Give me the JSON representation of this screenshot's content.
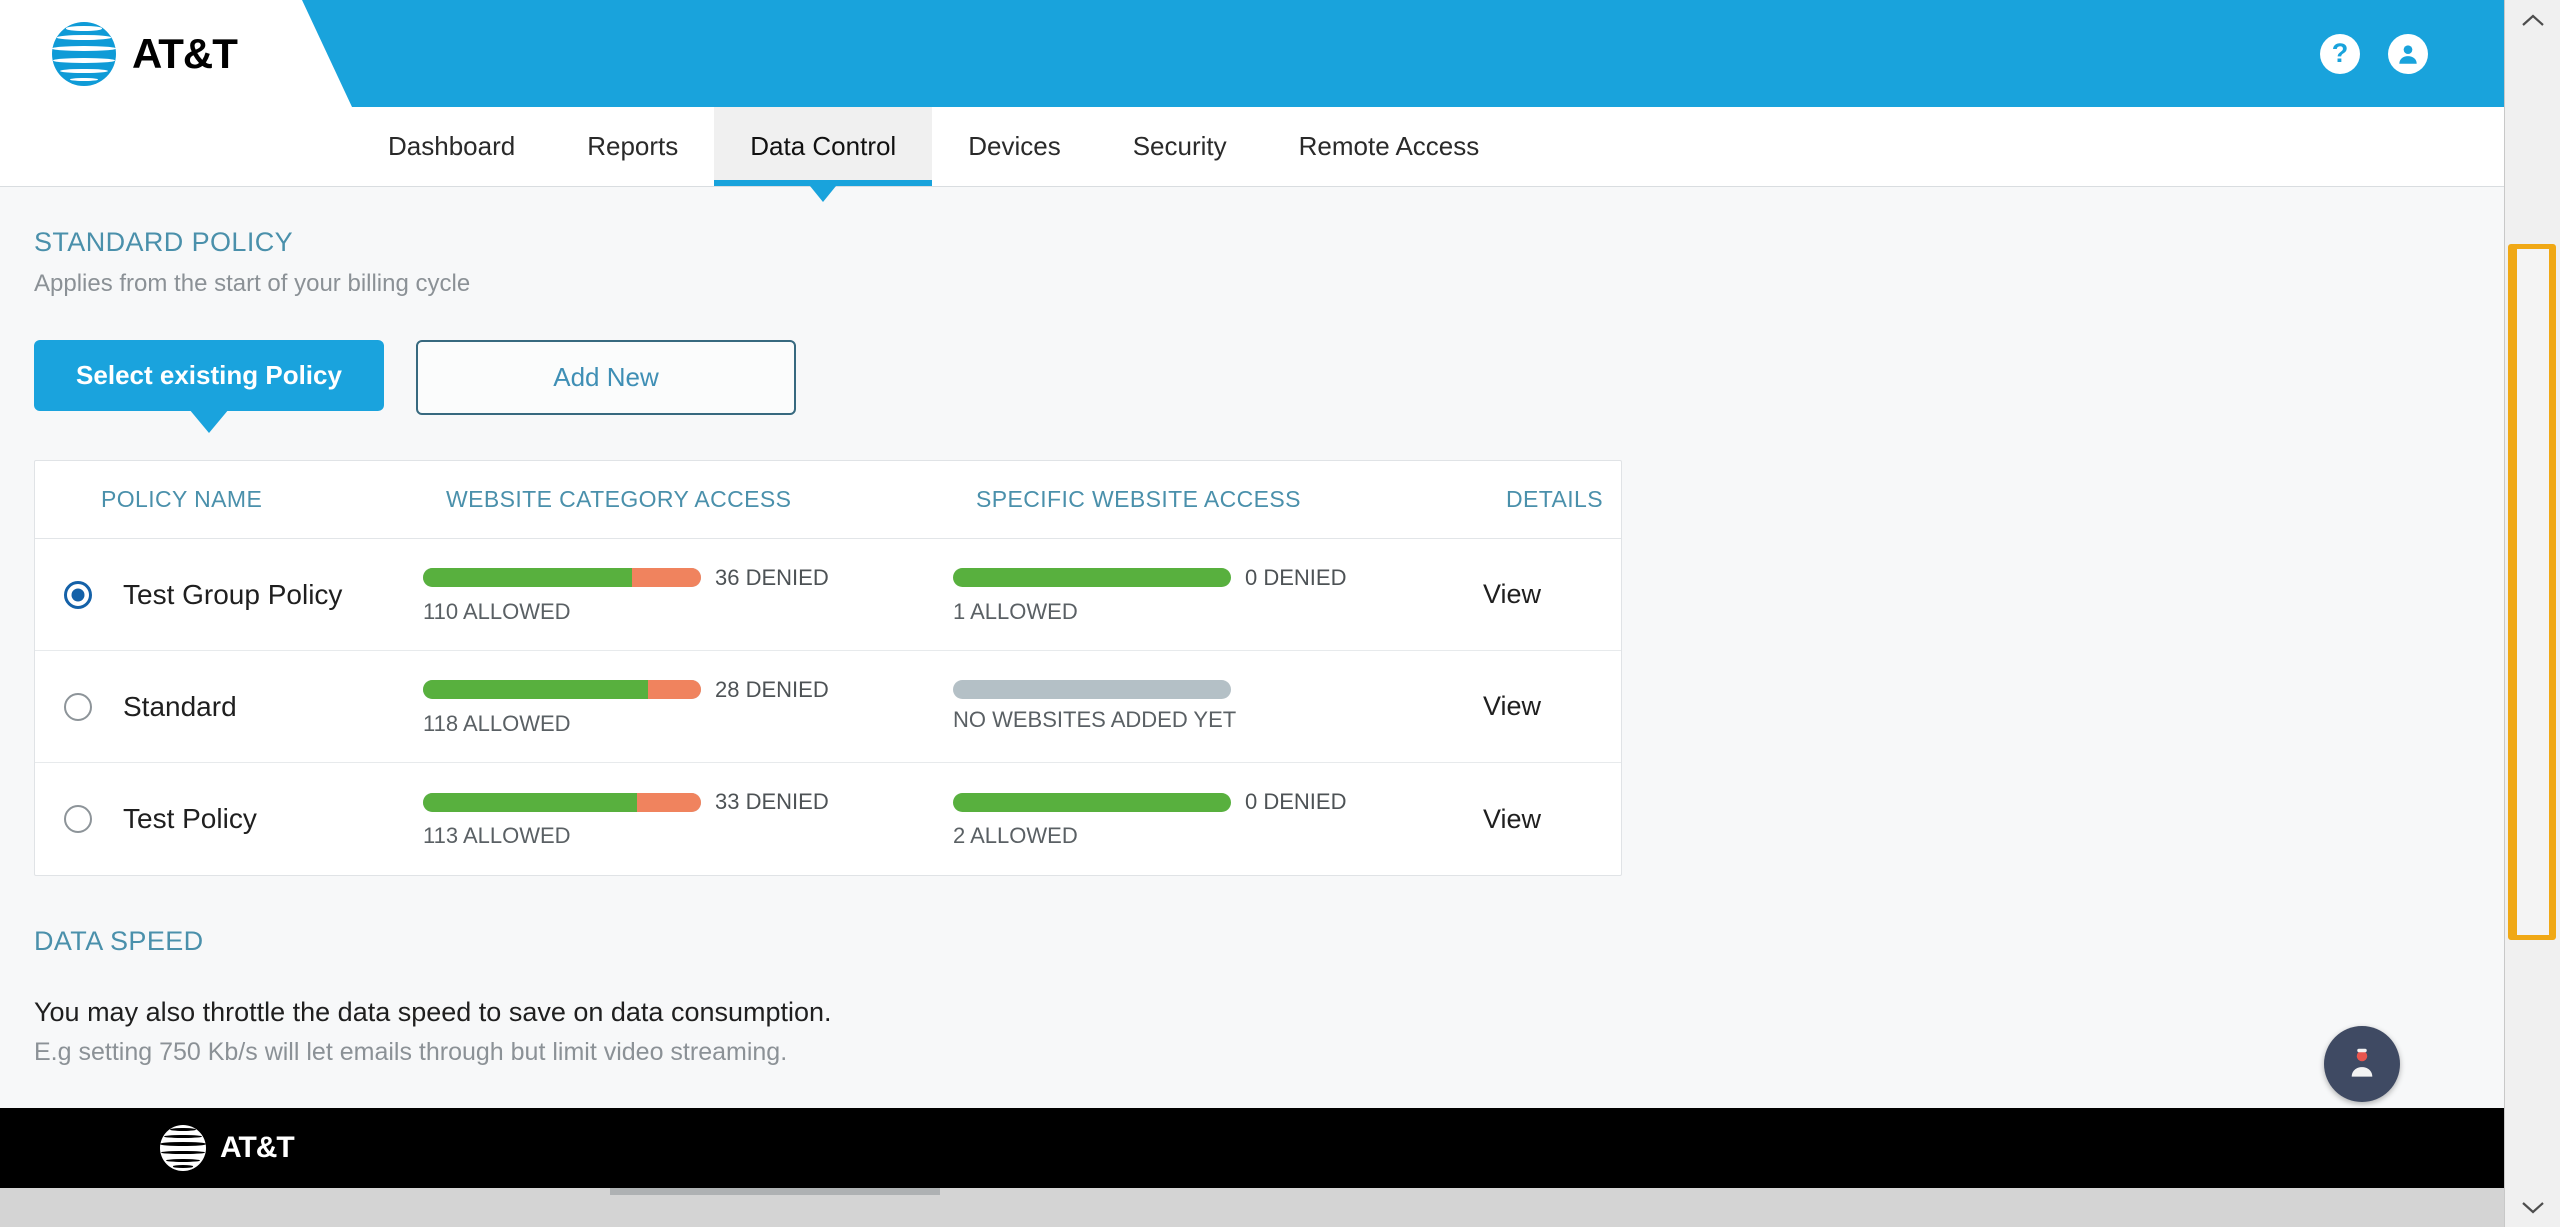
{
  "header": {
    "brand": "AT&T",
    "icons": [
      {
        "name": "help-icon",
        "glyph": "?"
      },
      {
        "name": "account-icon",
        "glyph": "person"
      }
    ]
  },
  "nav": {
    "items": [
      {
        "label": "Dashboard",
        "active": false
      },
      {
        "label": "Reports",
        "active": false
      },
      {
        "label": "Data Control",
        "active": true
      },
      {
        "label": "Devices",
        "active": false
      },
      {
        "label": "Security",
        "active": false
      },
      {
        "label": "Remote Access",
        "active": false
      }
    ]
  },
  "standard_policy": {
    "title": "STANDARD POLICY",
    "subtitle": "Applies from the start of your billing cycle",
    "select_existing_label": "Select existing Policy",
    "add_new_label": "Add New"
  },
  "policy_table": {
    "headers": {
      "name": "POLICY NAME",
      "category_access": "WEBSITE CATEGORY ACCESS",
      "specific_access": "SPECIFIC WEBSITE ACCESS",
      "details": "DETAILS"
    },
    "details_link_label": "View",
    "rows": [
      {
        "name": "Test Group Policy",
        "selected": true,
        "category": {
          "denied_label": "36 DENIED",
          "allowed_label": "110 ALLOWED",
          "allowed": 110,
          "denied": 36,
          "allowed_pct": 75
        },
        "specific": {
          "denied_label": "0 DENIED",
          "allowed_label": "1 ALLOWED",
          "allowed": 1,
          "denied": 0,
          "allowed_pct": 100,
          "empty": false
        },
        "details": "View"
      },
      {
        "name": "Standard",
        "selected": false,
        "category": {
          "denied_label": "28 DENIED",
          "allowed_label": "118 ALLOWED",
          "allowed": 118,
          "denied": 28,
          "allowed_pct": 81
        },
        "specific": {
          "denied_label": "",
          "allowed_label": "NO WEBSITES ADDED YET",
          "allowed": 0,
          "denied": 0,
          "allowed_pct": 0,
          "empty": true
        },
        "details": "View"
      },
      {
        "name": "Test Policy",
        "selected": false,
        "category": {
          "denied_label": "33 DENIED",
          "allowed_label": "113 ALLOWED",
          "allowed": 113,
          "denied": 33,
          "allowed_pct": 77
        },
        "specific": {
          "denied_label": "0 DENIED",
          "allowed_label": "2 ALLOWED",
          "allowed": 2,
          "denied": 0,
          "allowed_pct": 100,
          "empty": false
        },
        "details": "View"
      }
    ]
  },
  "data_speed": {
    "title": "DATA SPEED",
    "line1": "You may also throttle the data speed to save on data consumption.",
    "line2": "E.g setting 750 Kb/s will let emails through but limit video streaming."
  },
  "footer": {
    "brand": "AT&T"
  },
  "floating_button": {
    "name": "support-agent-icon"
  },
  "colors": {
    "brand_blue": "#19a3dc",
    "accent_link": "#4a90ab",
    "allowed_green": "#58b03e",
    "denied_orange": "#f0835e",
    "empty_gray": "#b4c0c6",
    "scrollbar_highlight": "#f0a815"
  }
}
